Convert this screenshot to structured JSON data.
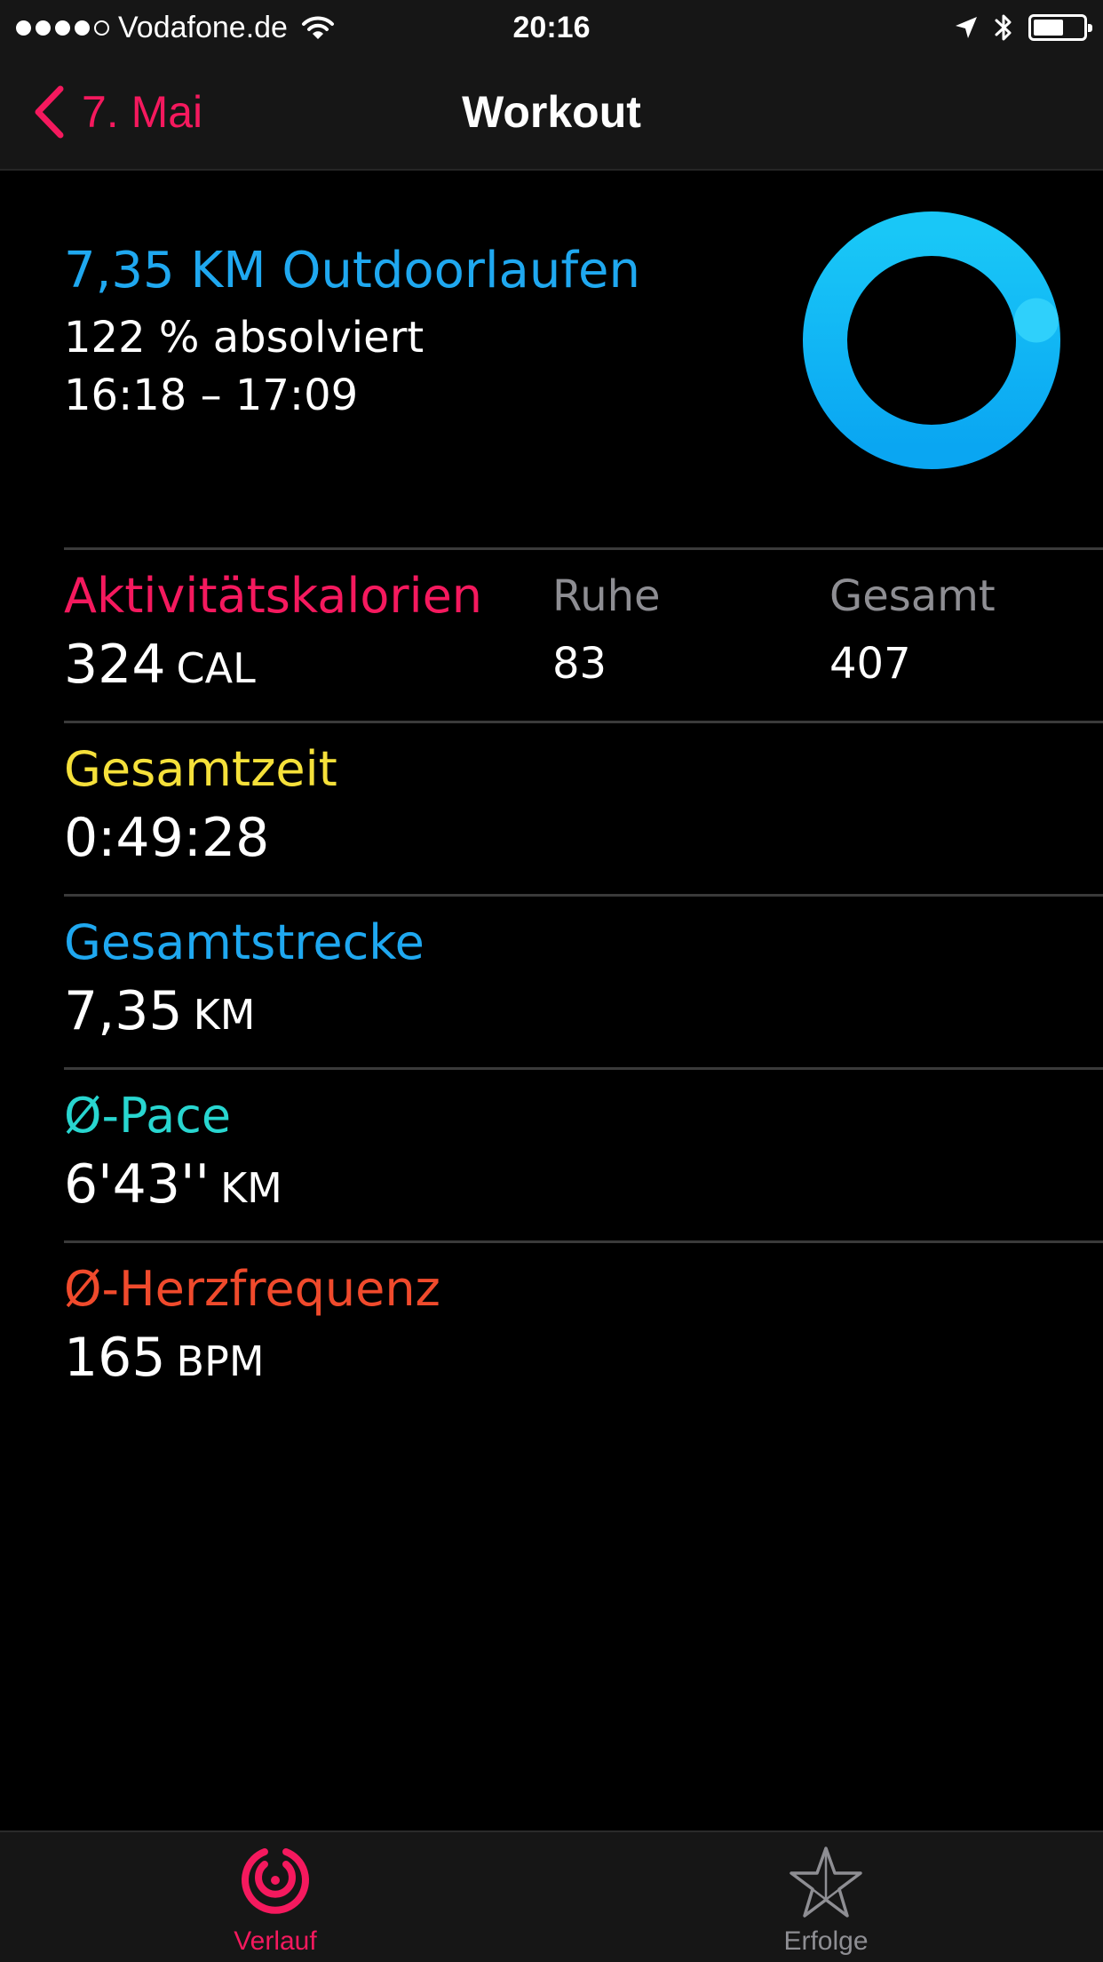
{
  "status_bar": {
    "carrier": "Vodafone.de",
    "time": "20:16",
    "battery_level": 0.65
  },
  "nav": {
    "back_label": "7. Mai",
    "title": "Workout"
  },
  "summary": {
    "title": "7,35 KM Outdoorlaufen",
    "completion": "122 % absolviert",
    "time_range": "16:18 – 17:09",
    "ring_progress": 1.22,
    "ring_color": "#1ab4f5"
  },
  "metrics": {
    "calories": {
      "label": "Aktivitätskalorien",
      "value": "324",
      "unit": "CAL",
      "rest_label": "Ruhe",
      "rest_value": "83",
      "total_label": "Gesamt",
      "total_value": "407",
      "color": "#f5195e"
    },
    "time": {
      "label": "Gesamtzeit",
      "value": "0:49:28",
      "color": "#f5e03a"
    },
    "distance": {
      "label": "Gesamtstrecke",
      "value": "7,35",
      "unit": "KM",
      "color": "#1fa8f0"
    },
    "pace": {
      "label": "Ø-Pace",
      "value": "6'43''",
      "unit": "KM",
      "color": "#28d6d0"
    },
    "heart_rate": {
      "label": "Ø-Herzfrequenz",
      "value": "165",
      "unit": "BPM",
      "color": "#f04a2c"
    }
  },
  "tab_bar": {
    "tabs": [
      {
        "label": "Verlauf",
        "icon": "activity-rings-icon",
        "active": true
      },
      {
        "label": "Erfolge",
        "icon": "star-icon",
        "active": false
      }
    ],
    "active_color": "#f5195e",
    "inactive_color": "#8e8e93"
  }
}
